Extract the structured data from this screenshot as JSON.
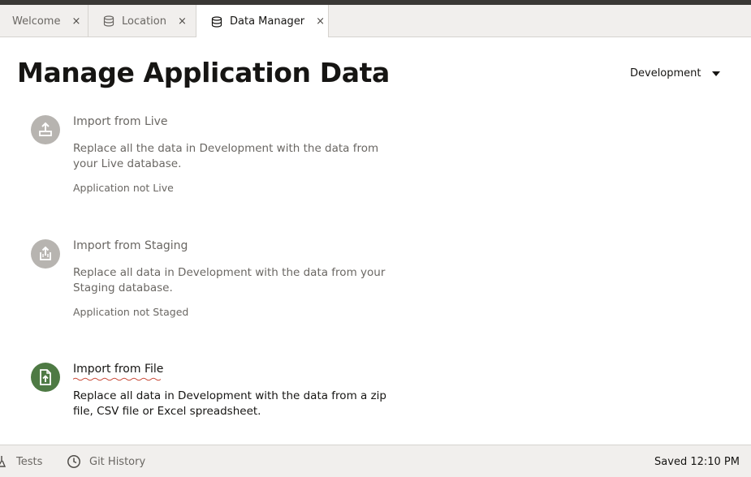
{
  "tabs": [
    {
      "label": "Welcome",
      "icon": "none",
      "active": false
    },
    {
      "label": "Location",
      "icon": "database-icon",
      "active": false
    },
    {
      "label": "Data Manager",
      "icon": "database-icon",
      "active": true
    }
  ],
  "close_glyph": "×",
  "page": {
    "title": "Manage Application Data",
    "environment": "Development"
  },
  "cards": [
    {
      "title": "Import from Live",
      "description": "Replace all the data in Development with the data from your Live database.",
      "status": "Application not Live",
      "icon": "import-icon",
      "enabled": false
    },
    {
      "title": "Import from Staging",
      "description": "Replace all data in Development with the data from your Staging database.",
      "status": "Application not Staged",
      "icon": "import-box-icon",
      "enabled": false
    },
    {
      "title": "Import from File",
      "description": "Replace all data in Development with the data from a zip file, CSV file or Excel spreadsheet.",
      "status": "",
      "icon": "file-upload-icon",
      "enabled": true
    }
  ],
  "footer": {
    "tests_label": "Tests",
    "git_label": "Git History",
    "saved_text": "Saved 12:10 PM"
  },
  "colors": {
    "accent_green": "#4e7a44",
    "disabled_gray": "#b7b4b0",
    "spellcheck_red": "#c74634"
  }
}
